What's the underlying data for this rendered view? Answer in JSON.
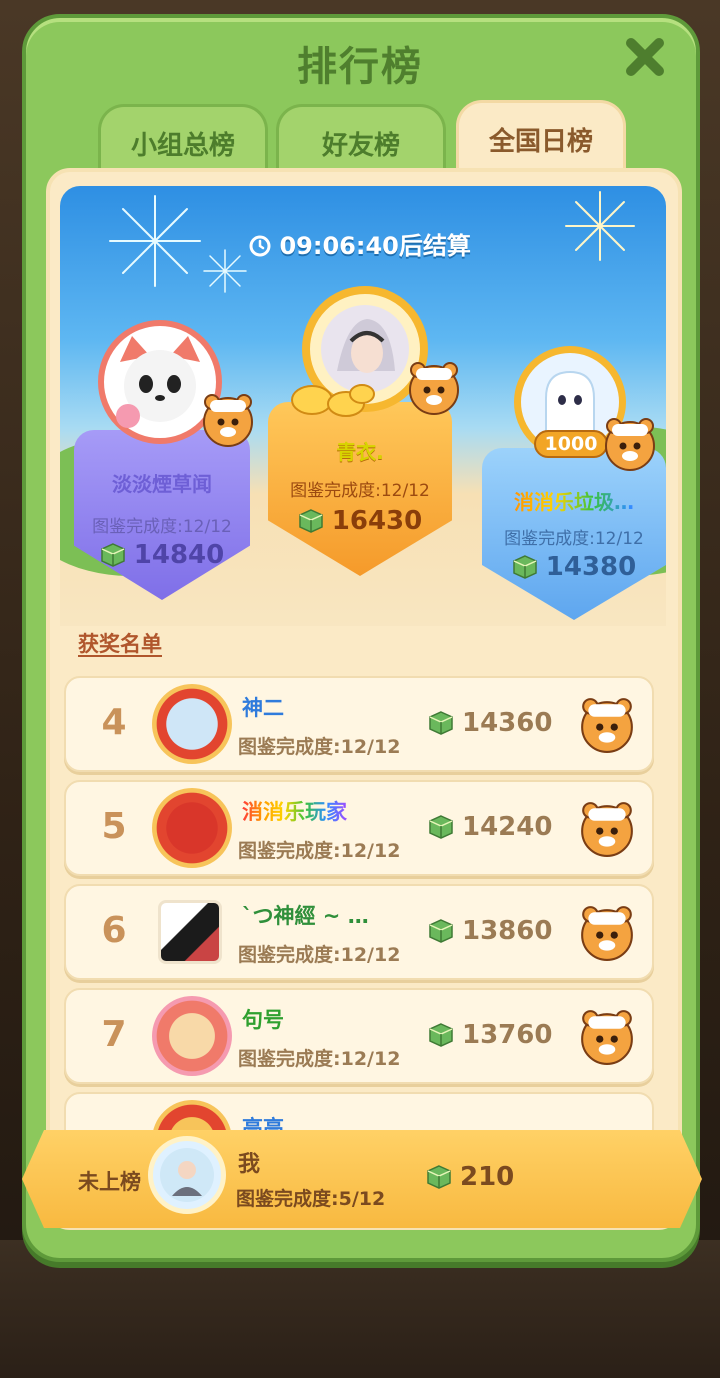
{
  "title": "排行榜",
  "tabs": [
    {
      "label": "小组总榜",
      "active": false
    },
    {
      "label": "好友榜",
      "active": false
    },
    {
      "label": "全国日榜",
      "active": true
    }
  ],
  "timer": "09:06:40后结算",
  "podium": [
    {
      "place": 1,
      "name": "青衣.",
      "progress": "图鉴完成度:12/12",
      "score": "16430"
    },
    {
      "place": 2,
      "name": "淡淡煙草闻",
      "progress": "图鉴完成度:12/12",
      "score": "14840"
    },
    {
      "place": 3,
      "name": "消消乐垃圾…",
      "progress": "图鉴完成度:12/12",
      "score": "14380",
      "badge": "1000"
    }
  ],
  "award_list_label": "获奖名单",
  "rows": [
    {
      "rank": "4",
      "name": "神二",
      "progress": "图鉴完成度:12/12",
      "score": "14360"
    },
    {
      "rank": "5",
      "name": "消消乐玩家",
      "progress": "图鉴完成度:12/12",
      "score": "14240"
    },
    {
      "rank": "6",
      "name": "`つ神經 ~ …",
      "progress": "图鉴完成度:12/12",
      "score": "13860"
    },
    {
      "rank": "7",
      "name": "句号",
      "progress": "图鉴完成度:12/12",
      "score": "13760"
    },
    {
      "rank": "8",
      "name": "高高",
      "progress": "",
      "score": ""
    }
  ],
  "me": {
    "rank_label": "未上榜",
    "name": "我",
    "progress": "图鉴完成度:5/12",
    "score": "210"
  },
  "colors": {
    "panel_green": "#8cc85c",
    "cream": "#fbeac6",
    "gold": "#f8b940",
    "purple_shield": "#8a7cf0",
    "orange_shield": "#f7a63a",
    "blue_shield": "#6fb4f4"
  },
  "icons": [
    "close-icon",
    "clock-icon",
    "cube-icon",
    "tiger-badge-icon"
  ]
}
